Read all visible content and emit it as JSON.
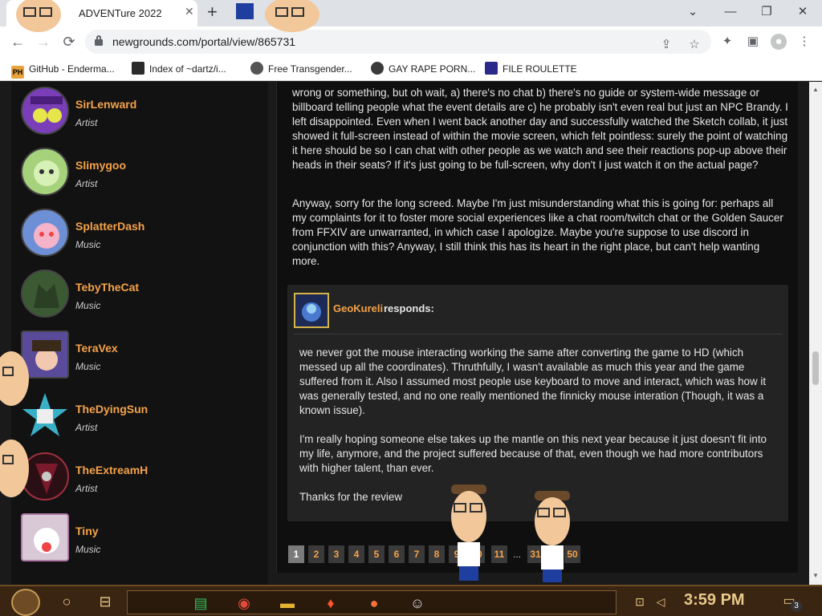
{
  "browser": {
    "tab_title": "ADVENTure 2022",
    "tab_close": "✕",
    "new_tab": "+",
    "url": "newgrounds.com/portal/view/865731",
    "window_controls": {
      "dropdown": "⌄",
      "minimize": "—",
      "restore": "❐",
      "close": "✕"
    },
    "nav": {
      "back": "←",
      "forward": "→",
      "reload": "⟳"
    },
    "toolbar_icons": [
      "share-icon",
      "star-icon",
      "puzzle-icon",
      "sidepanel-icon",
      "profile-icon",
      "menu-icon"
    ],
    "bookmarks": [
      {
        "label": "GitHub - Enderma...",
        "fav_color": "#e9a33b",
        "fav_text": "PH"
      },
      {
        "label": "Index of ~dartz/i...",
        "fav_color": "#2b2b2b",
        "fav_text": ""
      },
      {
        "label": "Free Transgender...",
        "fav_color": "#555555",
        "fav_text": ""
      },
      {
        "label": "GAY RAPE PORN...",
        "fav_color": "#3a3a3a",
        "fav_text": ""
      },
      {
        "label": "FILE ROULETTE",
        "fav_color": "#2a2a8a",
        "fav_text": ""
      }
    ]
  },
  "sidebar": {
    "artists": [
      {
        "name": "SirLenward",
        "role": "Artist",
        "color": "#7a3fb8"
      },
      {
        "name": "Slimygoo",
        "role": "Artist",
        "color": "#a7d27c"
      },
      {
        "name": "SplatterDash",
        "role": "Music",
        "color": "#6d8fd6"
      },
      {
        "name": "TebyTheCat",
        "role": "Music",
        "color": "#3b5a33"
      },
      {
        "name": "TeraVex",
        "role": "Music",
        "color": "#5a4a9a"
      },
      {
        "name": "TheDyingSun",
        "role": "Artist",
        "color": "#3ab0c8"
      },
      {
        "name": "TheExtreamH",
        "role": "Artist",
        "color": "#7a1a2a"
      },
      {
        "name": "Tiny",
        "role": "Music",
        "color": "#d9c8d6"
      }
    ]
  },
  "review": {
    "para1": "wrong or something, but oh wait, a) there's no chat b) there's no guide or system-wide message or billboard telling people what the event details are c) he probably isn't even real but just an NPC Brandy. I left disappointed. Even when I went back another day and successfully watched the Sketch collab, it just showed it full-screen instead of within the movie screen, which felt pointless: surely the point of watching it here should be so I can chat with other people as we watch and see their reactions pop-up above their heads in their seats? If it's just going to be full-screen, why don't I just watch it on the actual page?",
    "para2": "Anyway, sorry for the long screed. Maybe I'm just misunderstanding what this is going for: perhaps all my complaints for it to foster more social experiences like a chat room/twitch chat or the Golden Saucer from FFXIV are unwarranted, in which case I apologize. Maybe you're suppose to use discord in conjunction with this? Anyway, I still think this has its heart in the right place, but can't help wanting more."
  },
  "response": {
    "author": "GeoKureli",
    "verb": "responds:",
    "para1": "we never got the mouse interacting working the same after converting the game to HD (which messed up all the coordinates). Thruthfully, I wasn't available as much this year and the game suffered from it. Also I assumed most people use keyboard to move and interact, which was how it was generally tested, and no one really mentioned the finnicky mouse interation (Though, it was a known issue).",
    "para2": "I'm really hoping someone else takes up the mantle on this next year because it just doesn't fit into my life, anymore, and the project suffered because of that, even though we had more contributors with higher talent, than ever.",
    "para3": "Thanks for the review"
  },
  "pagination": {
    "pages": [
      "1",
      "2",
      "3",
      "4",
      "5",
      "6",
      "7",
      "8",
      "9",
      "10",
      "11",
      "31",
      "50"
    ],
    "active": "1",
    "ellipsis": "..."
  },
  "taskbar": {
    "clock": "3:59 PM",
    "apps": [
      "task-view-icon",
      "sheets-icon",
      "chrome-icon",
      "file-explorer-icon",
      "brave-icon",
      "firefox-icon",
      "theater-icon"
    ],
    "notification_count": "3"
  }
}
